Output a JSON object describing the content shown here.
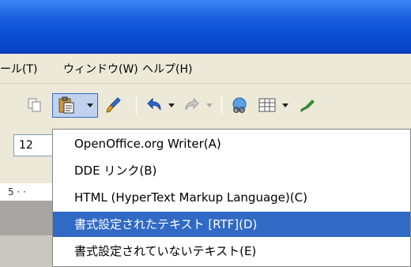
{
  "menubar": {
    "items": [
      {
        "label": "ール(T)"
      },
      {
        "label": "ウィンドウ(W)"
      },
      {
        "label": "ヘルプ(H)"
      }
    ]
  },
  "format_bar": {
    "font_size_value": "12"
  },
  "ruler": {
    "text": "5 · ·"
  },
  "paste_menu": {
    "selected_index": 3,
    "items": [
      {
        "label": "OpenOffice.org Writer(A)"
      },
      {
        "label": "DDE リンク(B)"
      },
      {
        "label": "HTML (HyperText Markup Language)(C)"
      },
      {
        "label": "書式設定されたテキスト [RTF](D)"
      },
      {
        "label": "書式設定されていないテキスト(E)"
      }
    ]
  },
  "colors": {
    "titlebar": "#0a4fd6",
    "selection": "#316ac5",
    "background": "#ece9d8"
  },
  "icons": [
    "copy-icon",
    "paste-icon",
    "paste-dropdown-arrow-icon",
    "format-paintbrush-icon",
    "undo-icon",
    "redo-icon",
    "hyperlink-icon",
    "table-icon",
    "draw-icon"
  ]
}
